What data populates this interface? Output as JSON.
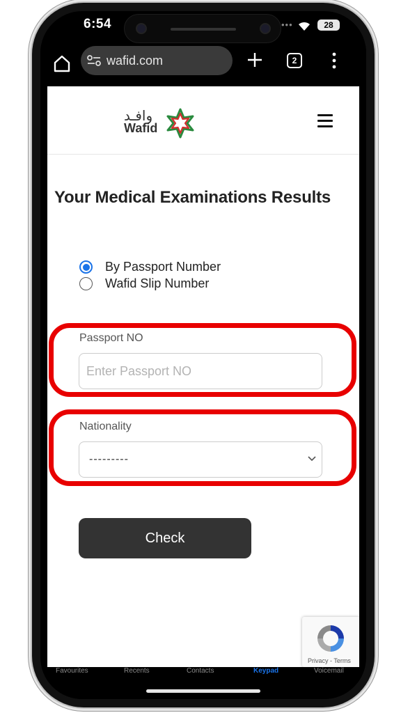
{
  "status_bar": {
    "time": "6:54",
    "dots": "•••",
    "battery": "28"
  },
  "browser": {
    "url": "wafid.com",
    "tab_count": "2",
    "icons": [
      "home-icon",
      "site-settings-icon",
      "plus-icon",
      "tabs-icon",
      "more-vert-icon"
    ]
  },
  "site": {
    "logo_arabic": "وافـد",
    "logo_english": "Wafid",
    "menu_icon": "hamburger-icon"
  },
  "form": {
    "title": "Your Medical Examinations Results",
    "radio_options": [
      {
        "label": "By Passport Number",
        "checked": true
      },
      {
        "label": "Wafid Slip Number",
        "checked": false
      }
    ],
    "passport_label": "Passport NO",
    "passport_placeholder": "Enter Passport NO",
    "passport_value": "",
    "nationality_label": "Nationality",
    "nationality_selected": "---------",
    "submit_label": "Check"
  },
  "recaptcha": {
    "links": "Privacy - Terms"
  },
  "underlying_tabbar": {
    "items": [
      {
        "label": "Favourites",
        "active": false
      },
      {
        "label": "Recents",
        "active": false
      },
      {
        "label": "Contacts",
        "active": false
      },
      {
        "label": "Keypad",
        "active": true
      },
      {
        "label": "Voicemail",
        "active": false
      }
    ]
  },
  "colors": {
    "highlight": "#e80000",
    "radio_accent": "#1a73e8",
    "button_bg": "#333333"
  }
}
